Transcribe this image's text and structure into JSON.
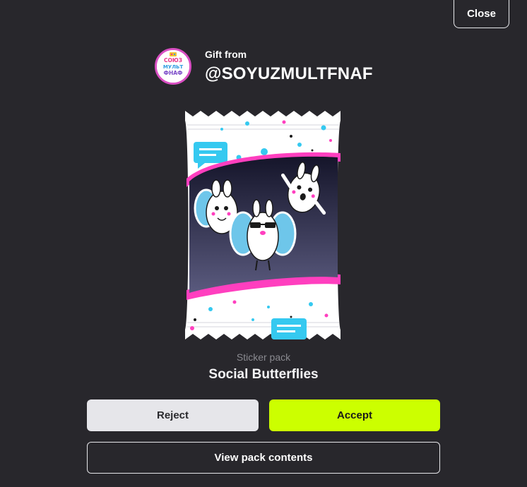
{
  "header": {
    "close_label": "Close"
  },
  "gift": {
    "from_label": "Gift from",
    "username": "@SOYUZMULTFNAF",
    "avatar_text_lines": [
      "СОЮЗ",
      "МУЛЬТ",
      "ФНАФ"
    ]
  },
  "pack": {
    "kind": "Sticker pack",
    "name": "Social Butterflies",
    "icon": "sticker-pack-wrapper-image"
  },
  "actions": {
    "reject_label": "Reject",
    "accept_label": "Accept",
    "view_contents_label": "View pack contents"
  },
  "colors": {
    "background": "#28272c",
    "accept": "#ccff00",
    "reject": "#e6e6ea",
    "accent_pink": "#ff3fbf",
    "accent_cyan": "#35c9f0"
  }
}
